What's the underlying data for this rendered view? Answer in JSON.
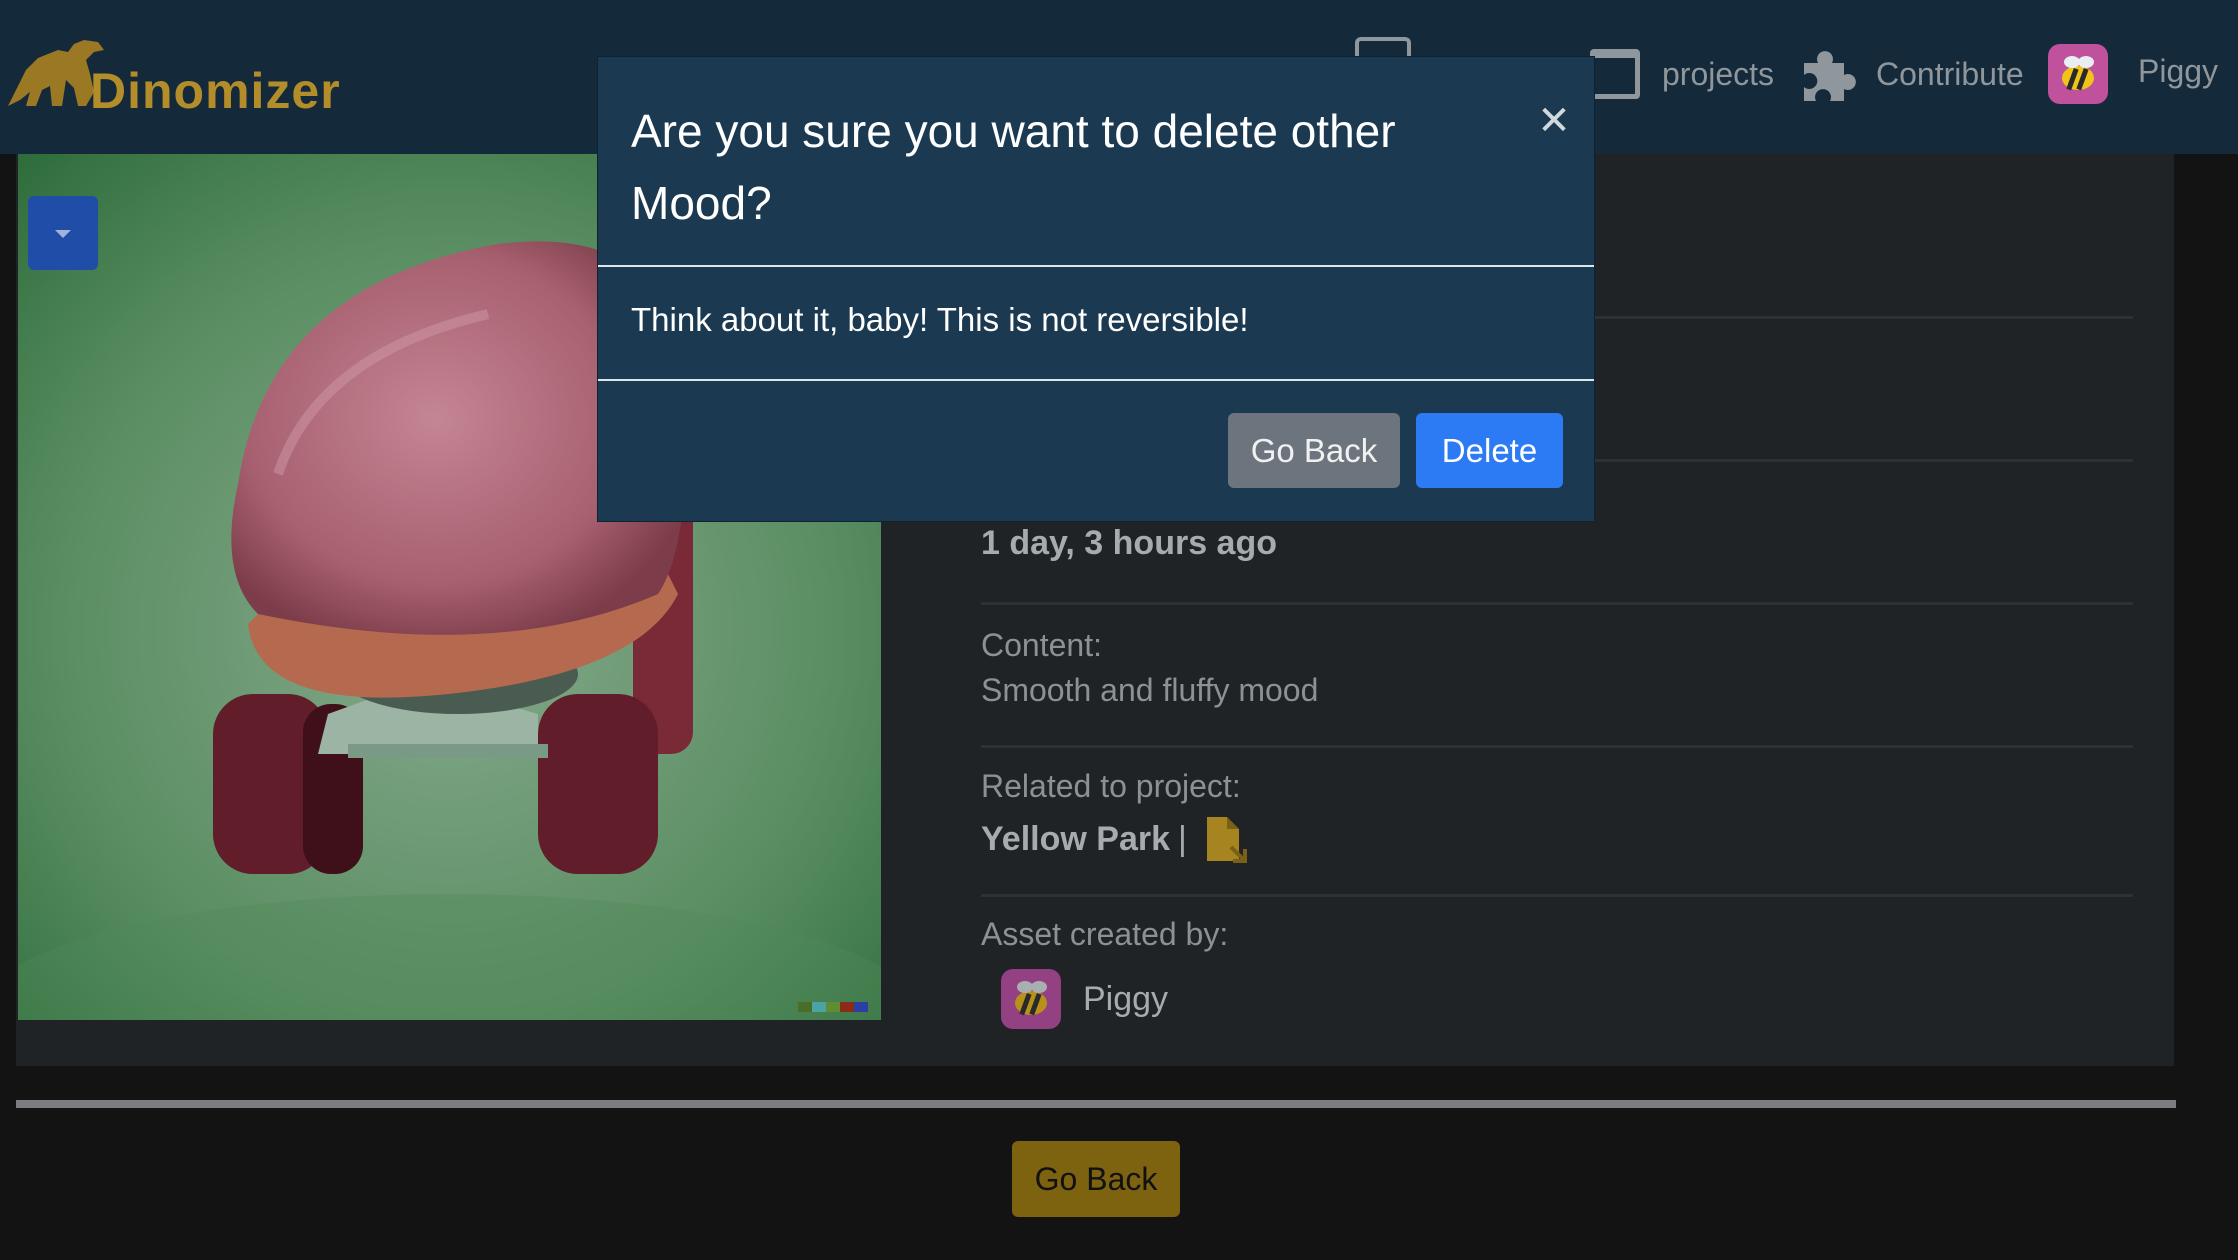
{
  "navbar": {
    "brand": "Dinomizer",
    "projects_label": "projects",
    "contribute_label": "Contribute",
    "user_name": "Piggy"
  },
  "asset": {
    "time_ago": "1 day, 3 hours ago",
    "content_label": "Content:",
    "content_value": "Smooth and fluffy mood",
    "project_label": "Related to project:",
    "project_name": "Yellow Park",
    "project_separator": "|",
    "creator_label": "Asset created by:",
    "creator_name": "Piggy"
  },
  "page": {
    "go_back_label": "Go Back"
  },
  "modal": {
    "title": "Are you sure you want to delete other Mood?",
    "close_glyph": "✕",
    "body": "Think about it, baby! This is not reversible!",
    "cancel_label": "Go Back",
    "confirm_label": "Delete"
  },
  "colors": {
    "navbar_bg": "#142a3a",
    "modal_bg": "#1b3a51",
    "brand": "#b38d2a",
    "primary": "#2d7bf4",
    "secondary": "#6c757d",
    "accent_yellow": "#7d6210"
  }
}
